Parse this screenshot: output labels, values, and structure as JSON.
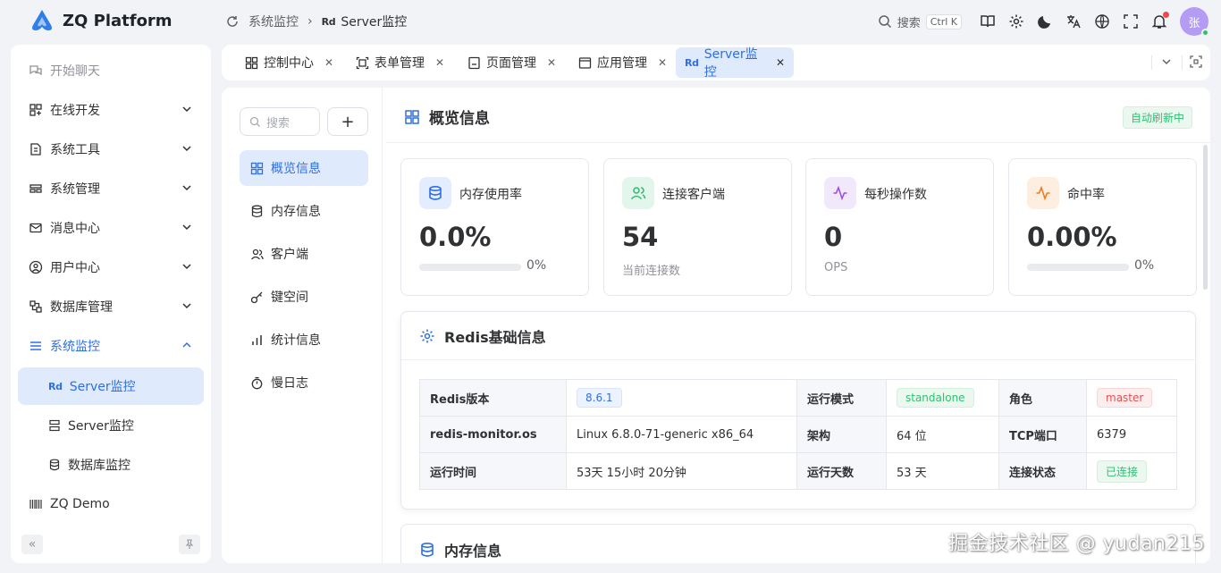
{
  "app": {
    "name": "ZQ Platform"
  },
  "breadcrumb": {
    "parent": "系统监控",
    "badge": "Rd",
    "current": "Server监控"
  },
  "toolbar": {
    "search_label": "搜索",
    "search_shortcut": "Ctrl K",
    "avatar_text": "张"
  },
  "sidebar": {
    "items": [
      {
        "label": "开始聊天",
        "icon": "chat-icon"
      },
      {
        "label": "在线开发",
        "icon": "code-icon"
      },
      {
        "label": "系统工具",
        "icon": "tool-icon"
      },
      {
        "label": "系统管理",
        "icon": "settings-icon"
      },
      {
        "label": "消息中心",
        "icon": "mail-icon"
      },
      {
        "label": "用户中心",
        "icon": "user-icon"
      },
      {
        "label": "数据库管理",
        "icon": "database-icon"
      },
      {
        "label": "系统监控",
        "icon": "menu-icon"
      }
    ],
    "sub_items": [
      {
        "badge": "Rd",
        "label": "Server监控"
      },
      {
        "label": "Server监控",
        "icon": "server-icon"
      },
      {
        "label": "数据库监控",
        "icon": "database-icon"
      }
    ],
    "demo": {
      "label": "ZQ Demo"
    }
  },
  "tabs": [
    {
      "label": "控制中心"
    },
    {
      "label": "表单管理"
    },
    {
      "label": "页面管理"
    },
    {
      "label": "应用管理"
    },
    {
      "label": "Server监控",
      "badge": "Rd"
    }
  ],
  "subnav": {
    "search_placeholder": "搜索",
    "items": [
      "概览信息",
      "内存信息",
      "客户端",
      "键空间",
      "统计信息",
      "慢日志"
    ]
  },
  "overview": {
    "title": "概览信息",
    "badge": "自动刷新中",
    "cards": [
      {
        "label": "内存使用率",
        "value": "0.0%",
        "percent_text": "0%",
        "progress": 0,
        "color": "#2f6fe4"
      },
      {
        "label": "连接客户端",
        "value": "54",
        "sub": "当前连接数",
        "color": "#2fbf71"
      },
      {
        "label": "每秒操作数",
        "value": "0",
        "sub": "OPS",
        "color": "#9b51e0"
      },
      {
        "label": "命中率",
        "value": "0.00%",
        "percent_text": "0%",
        "progress": 0,
        "color": "#f07a1a"
      }
    ]
  },
  "redis_info": {
    "title": "Redis基础信息",
    "rows": [
      [
        {
          "k": "Redis版本",
          "v": "8.6.1",
          "tag": "blue"
        },
        {
          "k": "运行模式",
          "v": "standalone",
          "tag": "green"
        },
        {
          "k": "角色",
          "v": "master",
          "tag": "red"
        }
      ],
      [
        {
          "k": "redis-monitor.os",
          "v": "Linux 6.8.0-71-generic x86_64"
        },
        {
          "k": "架构",
          "v": "64 位"
        },
        {
          "k": "TCP端口",
          "v": "6379"
        }
      ],
      [
        {
          "k": "运行时间",
          "v": "53天 15小时 20分钟"
        },
        {
          "k": "运行天数",
          "v": "53 天"
        },
        {
          "k": "连接状态",
          "v": "已连接",
          "tag": "green"
        }
      ]
    ]
  },
  "memory_section": {
    "title": "内存信息"
  },
  "watermark": "掘金技术社区 @ yudan215"
}
